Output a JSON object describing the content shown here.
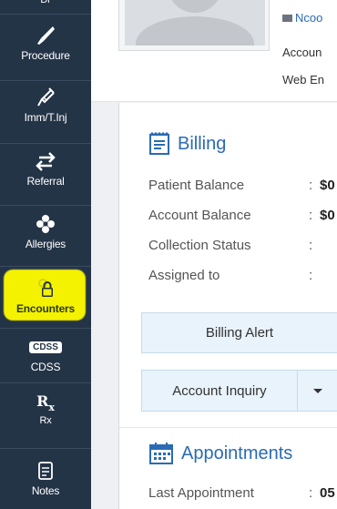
{
  "sidebar": {
    "items": [
      {
        "label": "Procedure",
        "icon": "scalpel-icon"
      },
      {
        "label": "Imm/T.Inj",
        "icon": "syringe-icon"
      },
      {
        "label": "Referral",
        "icon": "arrows-exchange-icon"
      },
      {
        "label": "Allergies",
        "icon": "flower-icon"
      },
      {
        "label": "Encounters",
        "icon": "user-lock-icon"
      },
      {
        "label": "CDSS",
        "icon": "cdss-badge-icon",
        "badge": "CDSS"
      },
      {
        "label": "Rx",
        "icon": "rx-icon",
        "glyph": "Rx"
      },
      {
        "label": "Notes",
        "icon": "notes-icon"
      }
    ],
    "active": "Encounters",
    "highlight_color": "#f5f200"
  },
  "contact": {
    "email": "Ncoo",
    "line1": "Accoun",
    "line2": "Web En"
  },
  "billing": {
    "title": "Billing",
    "rows": [
      {
        "label": "Patient Balance",
        "value": "$0"
      },
      {
        "label": "Account Balance",
        "value": "$0"
      },
      {
        "label": "Collection Status",
        "value": ""
      },
      {
        "label": "Assigned to",
        "value": ""
      }
    ],
    "alert_button": "Billing Alert",
    "inquiry_button": "Account Inquiry"
  },
  "appointments": {
    "title": "Appointments",
    "last_label": "Last Appointment",
    "last_value": "05"
  },
  "colors": {
    "sidebar": "#243447",
    "accent": "#2a6bb3",
    "button_bg": "#e8f3fb"
  }
}
